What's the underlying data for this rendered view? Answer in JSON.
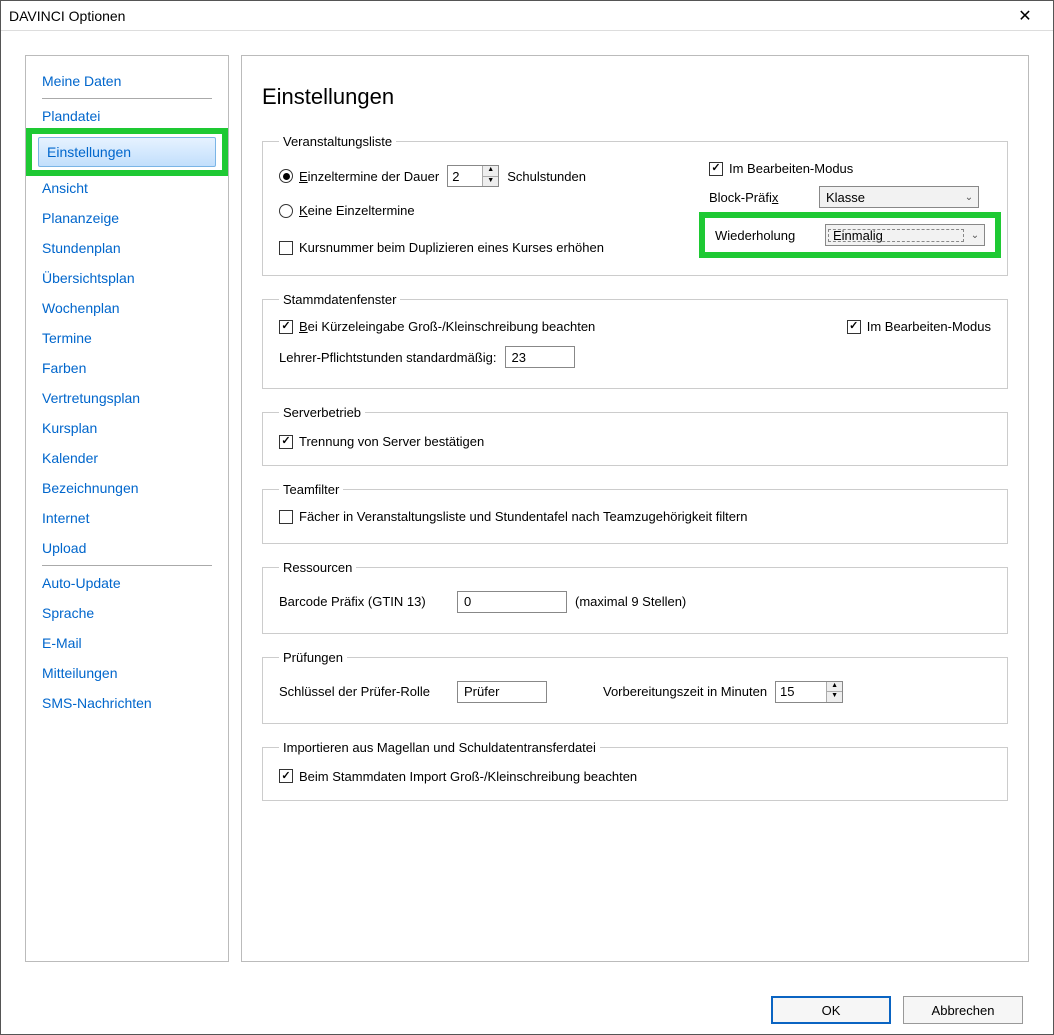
{
  "window": {
    "title": "DAVINCI Optionen"
  },
  "sidebar": {
    "groups": [
      {
        "items": [
          "Meine Daten",
          "Plandatei",
          "Einstellungen",
          "Ansicht",
          "Plananzeige",
          "Stundenplan",
          "Übersichtsplan",
          "Wochenplan",
          "Termine",
          "Farben",
          "Vertretungsplan",
          "Kursplan",
          "Kalender",
          "Bezeichnungen",
          "Internet",
          "Upload"
        ]
      },
      {
        "items": [
          "Auto-Update",
          "Sprache",
          "E-Mail",
          "Mitteilungen",
          "SMS-Nachrichten"
        ]
      }
    ],
    "selected": "Einstellungen"
  },
  "page": {
    "title": "Einstellungen"
  },
  "veranstaltungsliste": {
    "legend": "Veranstaltungsliste",
    "radio_einzel_prefix": "E",
    "radio_einzel_rest": "inzeltermine der Dauer",
    "dauer_value": "2",
    "schulstunden": "Schulstunden",
    "radio_keine_prefix": "K",
    "radio_keine_rest": "eine Einzeltermine",
    "bearbeiten_modus": "Im Bearbeiten-Modus",
    "block_praefix_label": "Block-Präfix",
    "block_praefix_value": "Klasse",
    "wiederholung_label": "Wiederholung",
    "wiederholung_value": "Einmalig",
    "kursnummer": "Kursnummer beim Duplizieren eines Kurses erhöhen"
  },
  "stammdaten": {
    "legend": "Stammdatenfenster",
    "kuerzel_prefix": "B",
    "kuerzel_rest": "ei Kürzeleingabe Groß-/Kleinschreibung beachten",
    "bearbeiten_modus": "Im Bearbeiten-Modus",
    "lehrer_label": "Lehrer-Pflichtstunden standardmäßig:",
    "lehrer_value": "23"
  },
  "serverbetrieb": {
    "legend": "Serverbetrieb",
    "trennung": "Trennung von Server bestätigen"
  },
  "teamfilter": {
    "legend": "Teamfilter",
    "faecher": "Fächer in Veranstaltungsliste und Stundentafel nach Teamzugehörigkeit filtern"
  },
  "ressourcen": {
    "legend": "Ressourcen",
    "barcode_label": "Barcode Präfix (GTIN 13)",
    "barcode_value": "0",
    "barcode_hint": "(maximal 9 Stellen)"
  },
  "pruefungen": {
    "legend": "Prüfungen",
    "rolle_label": "Schlüssel der Prüfer-Rolle",
    "rolle_value": "Prüfer",
    "vorbereitung_label": "Vorbereitungszeit in Minuten",
    "vorbereitung_value": "15"
  },
  "import": {
    "legend": "Importieren aus Magellan und Schuldatentransferdatei",
    "stammdaten": "Beim Stammdaten Import Groß-/Kleinschreibung beachten"
  },
  "footer": {
    "ok": "OK",
    "cancel": "Abbrechen"
  }
}
